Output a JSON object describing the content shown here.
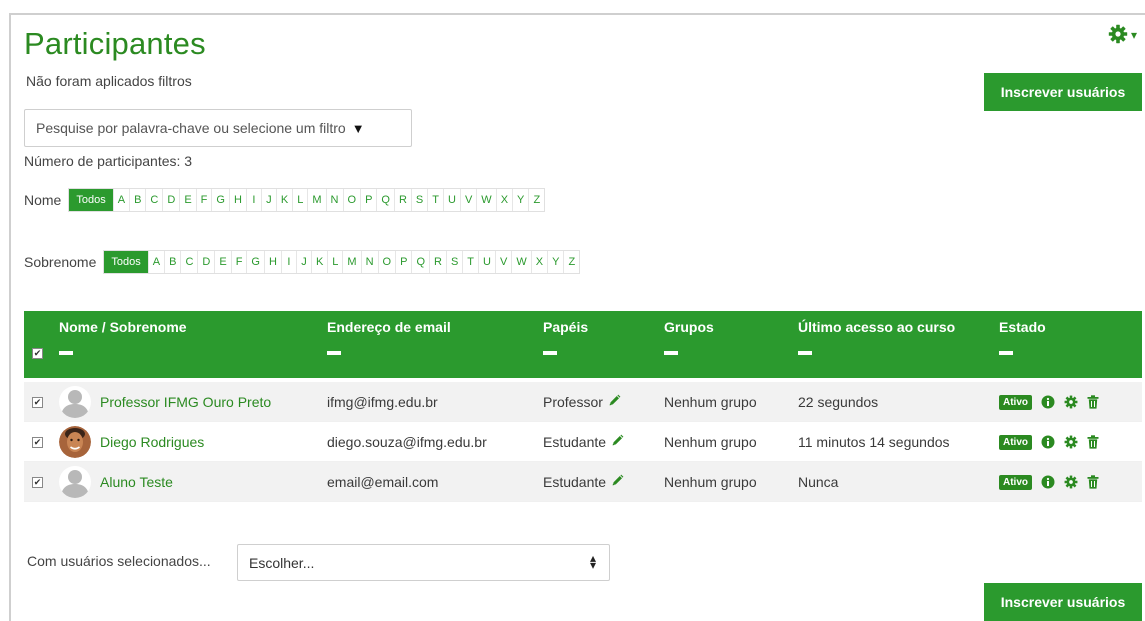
{
  "page": {
    "title": "Participantes",
    "filters_applied": "Não foram aplicados filtros",
    "enroll_button": "Inscrever usuários",
    "filter_placeholder": "Pesquise por palavra-chave ou selecione um filtro",
    "participant_count": "Número de participantes: 3"
  },
  "initials": {
    "first_name_label": "Nome",
    "last_name_label": "Sobrenome",
    "all_label": "Todos",
    "letters": [
      "A",
      "B",
      "C",
      "D",
      "E",
      "F",
      "G",
      "H",
      "I",
      "J",
      "K",
      "L",
      "M",
      "N",
      "O",
      "P",
      "Q",
      "R",
      "S",
      "T",
      "U",
      "V",
      "W",
      "X",
      "Y",
      "Z"
    ]
  },
  "table": {
    "headers": {
      "name": "Nome / Sobrenome",
      "email": "Endereço de email",
      "roles": "Papéis",
      "groups": "Grupos",
      "last_access": "Último acesso ao curso",
      "status": "Estado"
    },
    "rows": [
      {
        "name": "Professor IFMG Ouro Preto",
        "email": "ifmg@ifmg.edu.br",
        "role": "Professor",
        "group": "Nenhum grupo",
        "last_access": "22 segundos",
        "status": "Ativo",
        "avatar": "default-avatar",
        "checked": true
      },
      {
        "name": "Diego Rodrigues",
        "email": "diego.souza@ifmg.edu.br",
        "role": "Estudante",
        "group": "Nenhum grupo",
        "last_access": "11 minutos 14 segundos",
        "status": "Ativo",
        "avatar": "photo-avatar",
        "checked": true
      },
      {
        "name": "Aluno Teste",
        "email": "email@email.com",
        "role": "Estudante",
        "group": "Nenhum grupo",
        "last_access": "Nunca",
        "status": "Ativo",
        "avatar": "default-avatar",
        "checked": true
      }
    ]
  },
  "bulk": {
    "label": "Com usuários selecionados...",
    "selected_option": "Escolher..."
  },
  "colors": {
    "accent": "#2b9a2e",
    "link": "#2b8a21"
  }
}
